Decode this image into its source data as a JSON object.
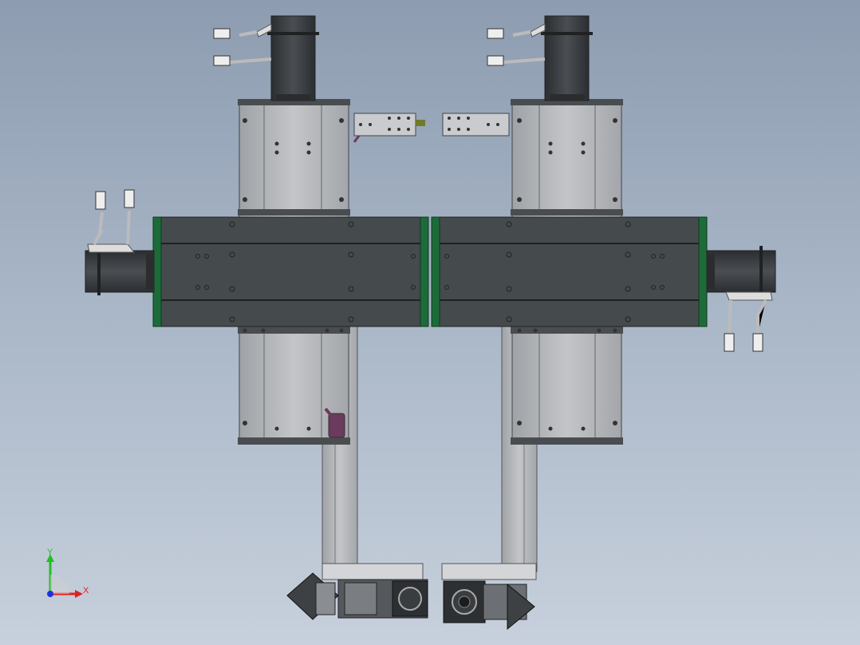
{
  "viewport": {
    "background_top": "#8d9cb0",
    "background_bottom": "#c7d0dc"
  },
  "model": {
    "frame_color": "#454a4d",
    "plate_color": "#b8babd",
    "end_cap_color": "#1e6b3a",
    "motor_color": "#3a3d40",
    "sensor_color": "#6b3a5e"
  },
  "triad": {
    "x_label": "X",
    "y_label": "Y",
    "x_color": "#e02020",
    "y_color": "#20c020",
    "z_color": "#2030e0"
  }
}
